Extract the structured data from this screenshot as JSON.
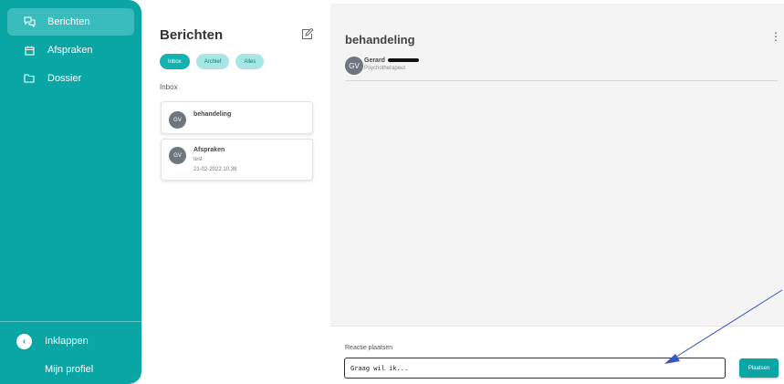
{
  "sidebar": {
    "items": [
      {
        "label": "Berichten",
        "icon": "chat-icon"
      },
      {
        "label": "Afspraken",
        "icon": "calendar-icon"
      },
      {
        "label": "Dossier",
        "icon": "folder-icon"
      }
    ],
    "collapse_label": "Inklappen",
    "profile_label": "Mijn profiel"
  },
  "messages": {
    "title": "Berichten",
    "filters": [
      "Inbox",
      "Archief",
      "Alles"
    ],
    "active_filter": "Inbox",
    "section_label": "Inbox",
    "list": [
      {
        "initials": "GV",
        "subject": "behandeling"
      },
      {
        "initials": "GV",
        "subject": "Afspraken",
        "preview": "test",
        "date": "21-02-2022 10:38"
      }
    ]
  },
  "detail": {
    "title": "behandeling",
    "sender_name": "Gerard",
    "sender_initials": "GV",
    "sender_role": "Psychotherapeut",
    "reply_label": "Reactie plaatsen",
    "reply_value": "Graag wil ik...",
    "post_button": "Plaatsen"
  },
  "colors": {
    "accent": "#0aa5a5",
    "accent_light": "#a8e6e6",
    "panel_bg": "#f4f4f4",
    "annotation_arrow": "#3355cc"
  }
}
